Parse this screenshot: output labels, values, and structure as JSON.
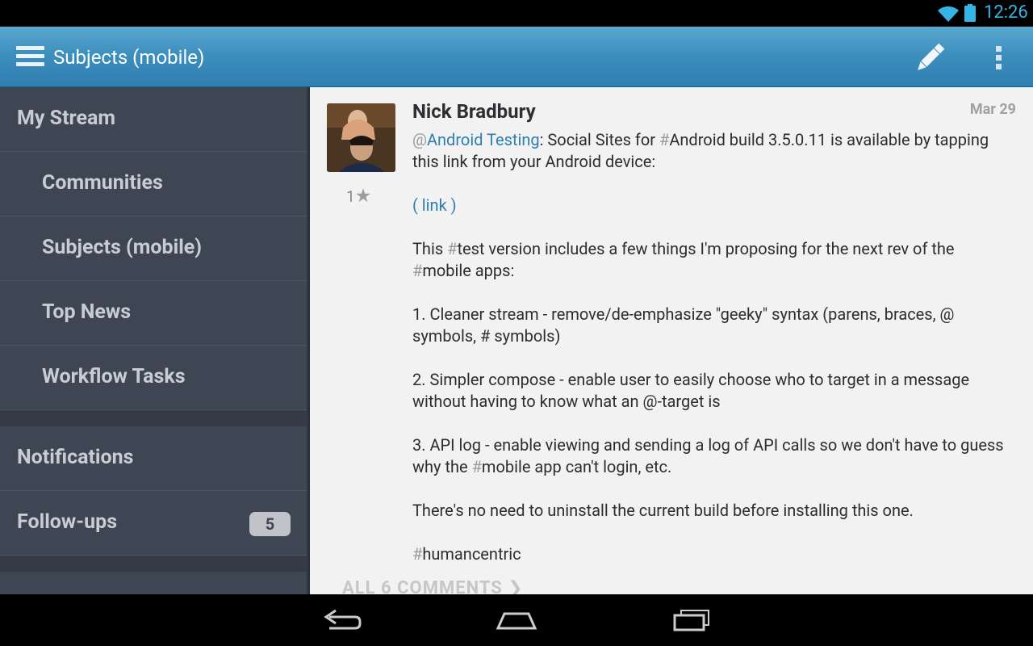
{
  "status_bar": {
    "time": "12:26"
  },
  "action_bar": {
    "title": "Subjects (mobile)"
  },
  "drawer": {
    "items": [
      {
        "label": "My Stream"
      },
      {
        "label": "Communities"
      },
      {
        "label": "Subjects (mobile)"
      },
      {
        "label": "Top News"
      },
      {
        "label": "Workflow Tasks"
      },
      {
        "label": "Notifications"
      },
      {
        "label": "Follow-ups",
        "badge": "5"
      }
    ]
  },
  "post": {
    "author": "Nick Bradbury",
    "date": "Mar 29",
    "likes": "1",
    "mention_at": "@",
    "mention": "Android Testing",
    "line1_a": ": Social Sites for ",
    "line1_hash": "#",
    "line1_b": "Android build 3.5.0.11 is available by tapping this link from your Android device:",
    "link": "( link )",
    "p2_a": "This ",
    "p2_hash1": "#",
    "p2_b": "test version includes a few things I'm proposing for the next rev of the ",
    "p2_hash2": "#",
    "p2_c": "mobile apps:",
    "item1": "1. Cleaner stream - remove/de-emphasize \"geeky\" syntax (parens, braces, @ symbols, # symbols)",
    "item2": "2. Simpler compose - enable user to easily choose who to target in a message without having to know what an @-target is",
    "item3_a": "3. API log - enable viewing and sending a log of API calls so we don't have to guess why the ",
    "item3_hash": "#",
    "item3_b": "mobile app can't login, etc.",
    "p_last": "There's no need to uninstall the current build before installing this one.",
    "tag_hash": "#",
    "tag": "humancentric",
    "comments": "ALL 6 COMMENTS"
  },
  "colors": {
    "accent": "#33b5e5",
    "actionbar": "#3d8fbe",
    "drawer": "#3e4553",
    "link": "#2c7fb1"
  }
}
